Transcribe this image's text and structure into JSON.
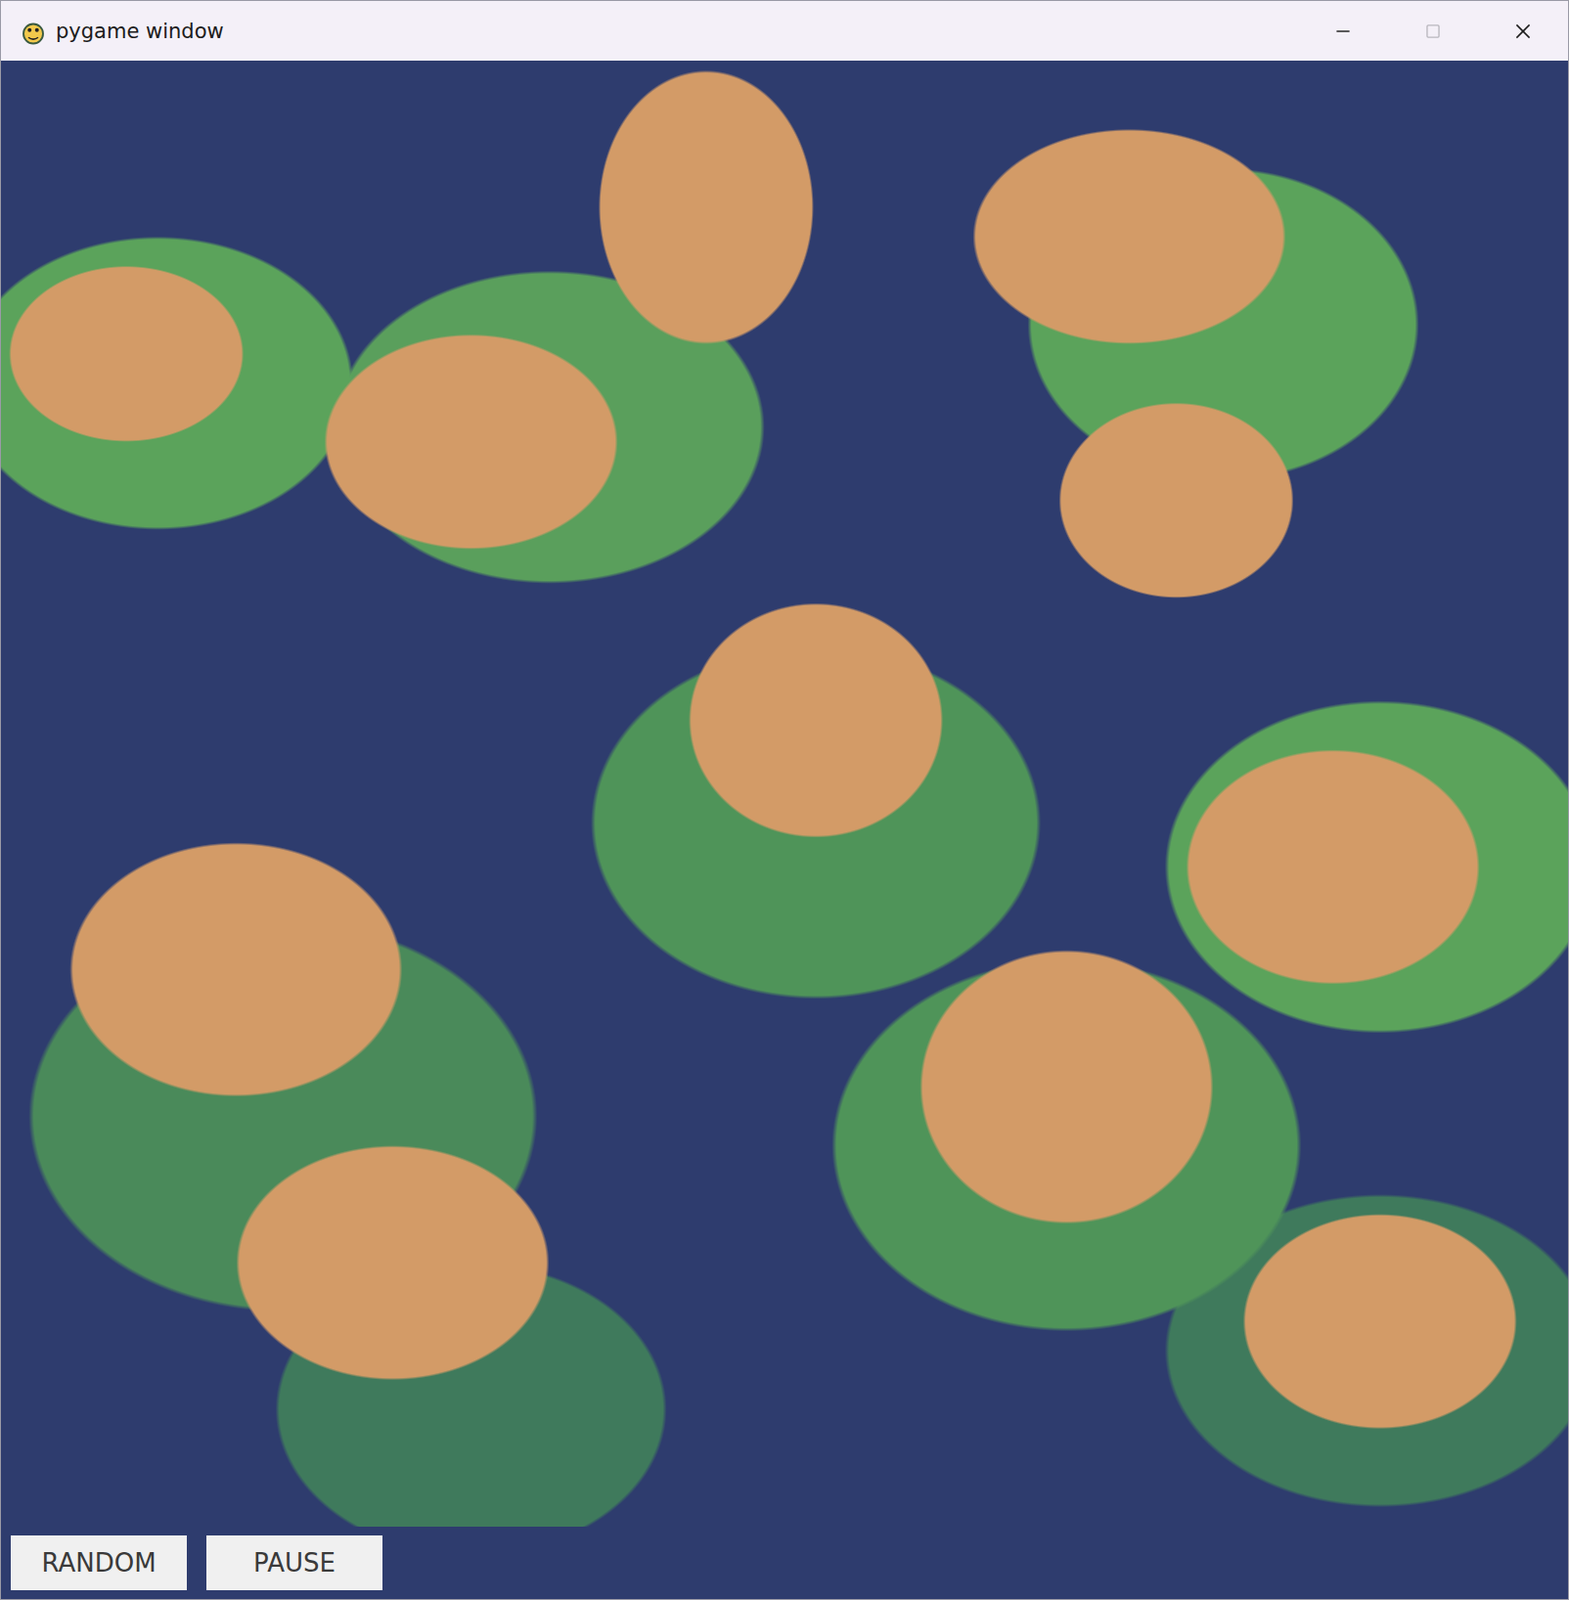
{
  "window": {
    "title": "pygame window",
    "controls": [
      {
        "kind": "minimize",
        "disabled": false
      },
      {
        "kind": "maximize",
        "disabled": true
      },
      {
        "kind": "close",
        "disabled": false
      }
    ]
  },
  "buttons": [
    {
      "label": "RANDOM"
    },
    {
      "label": "PAUSE"
    }
  ]
}
